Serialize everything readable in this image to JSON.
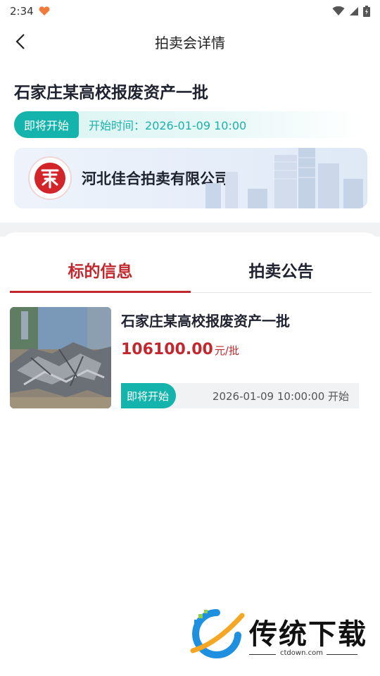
{
  "status_bar": {
    "time": "2:34"
  },
  "nav": {
    "title": "拍卖会详情"
  },
  "auction": {
    "title": "石家庄某高校报废资产一批",
    "status": "即将开始",
    "start_time": "开始时间：2026-01-09 10:00"
  },
  "company": {
    "name": "河北佳合拍卖有限公司"
  },
  "tabs": [
    {
      "label": "标的信息",
      "active": true
    },
    {
      "label": "拍卖公告",
      "active": false
    }
  ],
  "lots": [
    {
      "title": "石家庄某高校报废资产一批",
      "price": "106100.00",
      "unit": "元/批",
      "status": "即将开始",
      "start": "2026-01-09 10:00:00 开始"
    }
  ],
  "watermark": {
    "name": "传统下载",
    "url": "ctdown.com"
  },
  "colors": {
    "accent_red": "#c1272d",
    "teal": "#14b3ac"
  }
}
